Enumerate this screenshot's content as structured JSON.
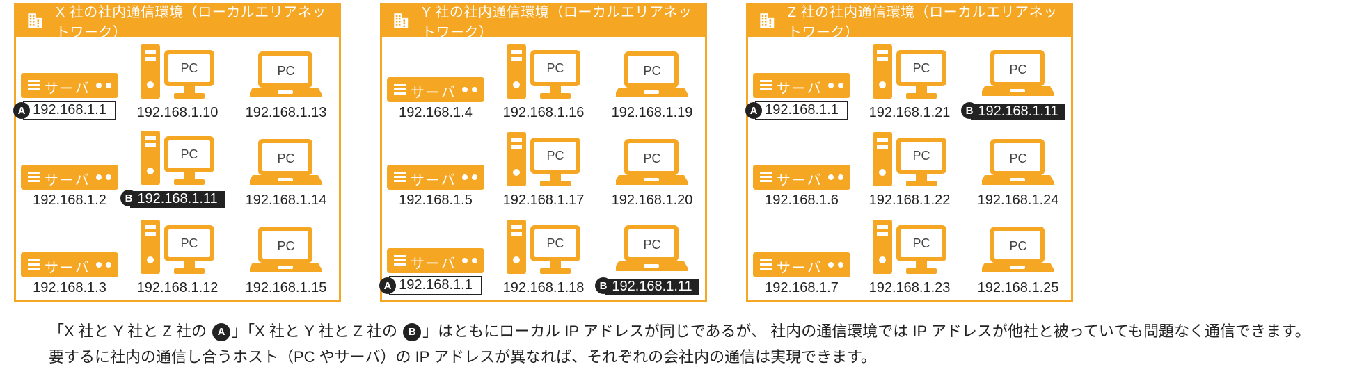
{
  "labels": {
    "server": "サーバ",
    "pc": "PC",
    "badgeA": "A",
    "badgeB": "B"
  },
  "panels": [
    {
      "id": "x",
      "title": "X 社の社内通信環境（ローカルエリアネットワーク）",
      "cells": [
        {
          "type": "server",
          "ip": "192.168.1.1",
          "style": "boxed",
          "badge": "A"
        },
        {
          "type": "desktop",
          "ip": "192.168.1.10"
        },
        {
          "type": "laptop",
          "ip": "192.168.1.13"
        },
        {
          "type": "server",
          "ip": "192.168.1.2"
        },
        {
          "type": "desktop",
          "ip": "192.168.1.11",
          "style": "solid",
          "badge": "B"
        },
        {
          "type": "laptop",
          "ip": "192.168.1.14"
        },
        {
          "type": "server",
          "ip": "192.168.1.3"
        },
        {
          "type": "desktop",
          "ip": "192.168.1.12"
        },
        {
          "type": "laptop",
          "ip": "192.168.1.15"
        }
      ]
    },
    {
      "id": "y",
      "title": "Y 社の社内通信環境（ローカルエリアネットワーク）",
      "cells": [
        {
          "type": "server",
          "ip": "192.168.1.4"
        },
        {
          "type": "desktop",
          "ip": "192.168.1.16"
        },
        {
          "type": "laptop",
          "ip": "192.168.1.19"
        },
        {
          "type": "server",
          "ip": "192.168.1.5"
        },
        {
          "type": "desktop",
          "ip": "192.168.1.17"
        },
        {
          "type": "laptop",
          "ip": "192.168.1.20"
        },
        {
          "type": "server",
          "ip": "192.168.1.1",
          "style": "boxed",
          "badge": "A"
        },
        {
          "type": "desktop",
          "ip": "192.168.1.18"
        },
        {
          "type": "laptop",
          "ip": "192.168.1.11",
          "style": "solid",
          "badge": "B"
        }
      ]
    },
    {
      "id": "z",
      "title": "Z 社の社内通信環境（ローカルエリアネットワーク）",
      "cells": [
        {
          "type": "server",
          "ip": "192.168.1.1",
          "style": "boxed",
          "badge": "A"
        },
        {
          "type": "desktop",
          "ip": "192.168.1.21"
        },
        {
          "type": "laptop",
          "ip": "192.168.1.11",
          "style": "solid",
          "badge": "B"
        },
        {
          "type": "server",
          "ip": "192.168.1.6"
        },
        {
          "type": "desktop",
          "ip": "192.168.1.22"
        },
        {
          "type": "laptop",
          "ip": "192.168.1.24"
        },
        {
          "type": "server",
          "ip": "192.168.1.7"
        },
        {
          "type": "desktop",
          "ip": "192.168.1.23"
        },
        {
          "type": "laptop",
          "ip": "192.168.1.25"
        }
      ]
    }
  ],
  "footer": {
    "line1a": "「X 社と Y 社と Z 社の ",
    "line1b": "」「X 社と Y 社と Z 社の ",
    "line1c": "」はともにローカル IP アドレスが同じであるが、 社内の通信環境では IP アドレスが他社と被っていても問題なく通信できます。",
    "line2": "要するに社内の通信し合うホスト（PC やサーバ）の IP アドレスが異なれば、それぞれの会社内の通信は実現できます。"
  }
}
